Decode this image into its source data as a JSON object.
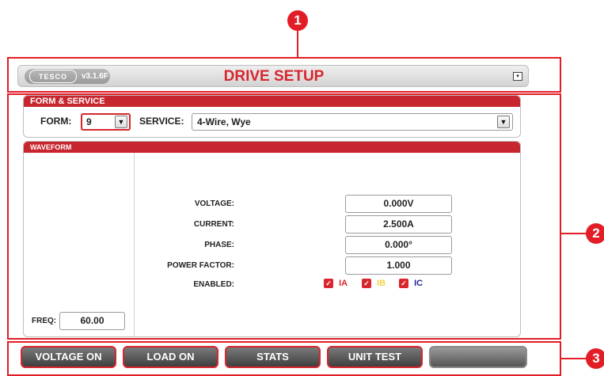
{
  "callouts": {
    "one": "1",
    "two": "2",
    "three": "3"
  },
  "header": {
    "logo_text": "TESCO",
    "version": "v3.1.6F",
    "title": "DRIVE SETUP",
    "icon": "monitor-icon"
  },
  "form_service": {
    "panel_title": "FORM & SERVICE",
    "form_label": "FORM:",
    "form_value": "9",
    "service_label": "SERVICE:",
    "service_value": "4-Wire, Wye"
  },
  "waveform": {
    "panel_title": "WAVEFORM",
    "voltage_label": "VOLTAGE:",
    "voltage_value": "0.000V",
    "current_label": "CURRENT:",
    "current_value": "2.500A",
    "phase_label": "PHASE:",
    "phase_value": "0.000°",
    "pf_label": "POWER FACTOR:",
    "pf_value": "1.000",
    "enabled_label": "ENABLED:",
    "phases": [
      {
        "label": "IA",
        "color": "#d7262e",
        "checked": true
      },
      {
        "label": "IB",
        "color": "#f5d04a",
        "checked": true
      },
      {
        "label": "IC",
        "color": "#1f2a9e",
        "checked": true
      }
    ],
    "freq_label": "FREQ:",
    "freq_value": "60.00"
  },
  "buttons": {
    "voltage_on": "VOLTAGE ON",
    "load_on": "LOAD ON",
    "stats": "STATS",
    "unit_test": "UNIT TEST",
    "blank": ""
  },
  "colors": {
    "accent": "#d7262e",
    "panel_header": "#c8262e"
  }
}
